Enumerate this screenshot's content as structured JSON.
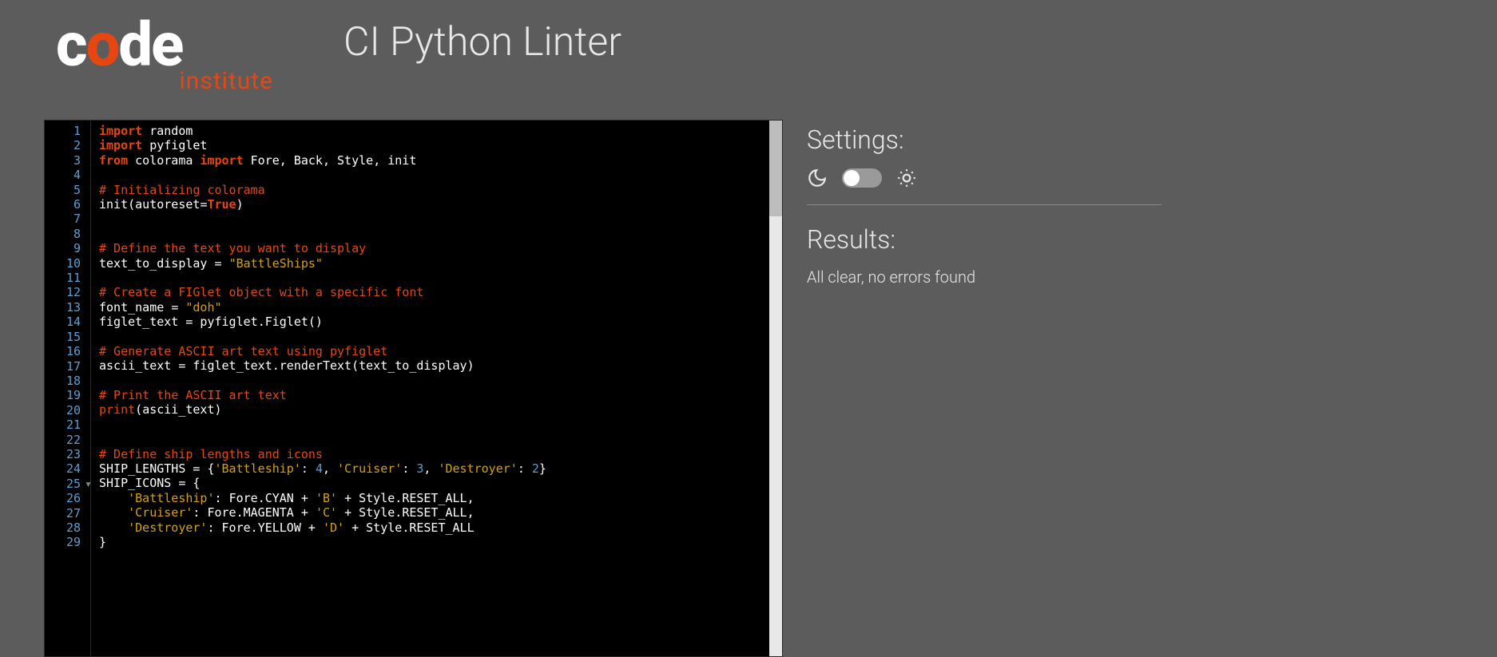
{
  "header": {
    "logo_code_c": "c",
    "logo_code_o": "o",
    "logo_code_de": "de",
    "logo_institute": "institute",
    "title": "CI Python Linter"
  },
  "editor": {
    "line_count": 29,
    "fold_line": 25,
    "lines": [
      [
        [
          "kw",
          "import"
        ],
        [
          "id",
          " random"
        ]
      ],
      [
        [
          "kw",
          "import"
        ],
        [
          "id",
          " pyfiglet"
        ]
      ],
      [
        [
          "kw",
          "from"
        ],
        [
          "id",
          " colorama "
        ],
        [
          "kw",
          "import"
        ],
        [
          "id",
          " Fore"
        ],
        [
          "sep",
          ","
        ],
        [
          "id",
          " Back"
        ],
        [
          "sep",
          ","
        ],
        [
          "id",
          " Style"
        ],
        [
          "sep",
          ","
        ],
        [
          "id",
          " init"
        ]
      ],
      [],
      [
        [
          "cm",
          "# Initializing colorama"
        ]
      ],
      [
        [
          "id",
          "init"
        ],
        [
          "sep",
          "("
        ],
        [
          "id",
          "autoreset"
        ],
        [
          "op",
          "="
        ],
        [
          "bool",
          "True"
        ],
        [
          "sep",
          ")"
        ]
      ],
      [],
      [],
      [
        [
          "cm",
          "# Define the text you want to display"
        ]
      ],
      [
        [
          "id",
          "text_to_display "
        ],
        [
          "op",
          "="
        ],
        [
          "id",
          " "
        ],
        [
          "str",
          "\"BattleShips\""
        ]
      ],
      [],
      [
        [
          "cm",
          "# Create a FIGlet object with a specific font"
        ]
      ],
      [
        [
          "id",
          "font_name "
        ],
        [
          "op",
          "="
        ],
        [
          "id",
          " "
        ],
        [
          "str",
          "\"doh\""
        ]
      ],
      [
        [
          "id",
          "figlet_text "
        ],
        [
          "op",
          "="
        ],
        [
          "id",
          " pyfiglet"
        ],
        [
          "sep",
          "."
        ],
        [
          "id",
          "Figlet"
        ],
        [
          "sep",
          "()"
        ]
      ],
      [],
      [
        [
          "cm",
          "# Generate ASCII art text using pyfiglet"
        ]
      ],
      [
        [
          "id",
          "ascii_text "
        ],
        [
          "op",
          "="
        ],
        [
          "id",
          " figlet_text"
        ],
        [
          "sep",
          "."
        ],
        [
          "id",
          "renderText"
        ],
        [
          "sep",
          "("
        ],
        [
          "id",
          "text_to_display"
        ],
        [
          "sep",
          ")"
        ]
      ],
      [],
      [
        [
          "cm",
          "# Print the ASCII art text"
        ]
      ],
      [
        [
          "fn",
          "print"
        ],
        [
          "sep",
          "("
        ],
        [
          "id",
          "ascii_text"
        ],
        [
          "sep",
          ")"
        ]
      ],
      [],
      [],
      [
        [
          "cm",
          "# Define ship lengths and icons"
        ]
      ],
      [
        [
          "id",
          "SHIP_LENGTHS "
        ],
        [
          "op",
          "="
        ],
        [
          "id",
          " "
        ],
        [
          "sep",
          "{"
        ],
        [
          "str",
          "'Battleship'"
        ],
        [
          "sep",
          ": "
        ],
        [
          "num",
          "4"
        ],
        [
          "sep",
          ", "
        ],
        [
          "str",
          "'Cruiser'"
        ],
        [
          "sep",
          ": "
        ],
        [
          "num",
          "3"
        ],
        [
          "sep",
          ", "
        ],
        [
          "str",
          "'Destroyer'"
        ],
        [
          "sep",
          ": "
        ],
        [
          "num",
          "2"
        ],
        [
          "sep",
          "}"
        ]
      ],
      [
        [
          "id",
          "SHIP_ICONS "
        ],
        [
          "op",
          "="
        ],
        [
          "id",
          " "
        ],
        [
          "sep",
          "{"
        ]
      ],
      [
        [
          "id",
          "    "
        ],
        [
          "str",
          "'Battleship'"
        ],
        [
          "sep",
          ": "
        ],
        [
          "id",
          "Fore"
        ],
        [
          "sep",
          "."
        ],
        [
          "id",
          "CYAN "
        ],
        [
          "op",
          "+"
        ],
        [
          "id",
          " "
        ],
        [
          "str",
          "'B'"
        ],
        [
          "id",
          " "
        ],
        [
          "op",
          "+"
        ],
        [
          "id",
          " Style"
        ],
        [
          "sep",
          "."
        ],
        [
          "id",
          "RESET_ALL"
        ],
        [
          "sep",
          ","
        ]
      ],
      [
        [
          "id",
          "    "
        ],
        [
          "str",
          "'Cruiser'"
        ],
        [
          "sep",
          ": "
        ],
        [
          "id",
          "Fore"
        ],
        [
          "sep",
          "."
        ],
        [
          "id",
          "MAGENTA "
        ],
        [
          "op",
          "+"
        ],
        [
          "id",
          " "
        ],
        [
          "str",
          "'C'"
        ],
        [
          "id",
          " "
        ],
        [
          "op",
          "+"
        ],
        [
          "id",
          " Style"
        ],
        [
          "sep",
          "."
        ],
        [
          "id",
          "RESET_ALL"
        ],
        [
          "sep",
          ","
        ]
      ],
      [
        [
          "id",
          "    "
        ],
        [
          "str",
          "'Destroyer'"
        ],
        [
          "sep",
          ": "
        ],
        [
          "id",
          "Fore"
        ],
        [
          "sep",
          "."
        ],
        [
          "id",
          "YELLOW "
        ],
        [
          "op",
          "+"
        ],
        [
          "id",
          " "
        ],
        [
          "str",
          "'D'"
        ],
        [
          "id",
          " "
        ],
        [
          "op",
          "+"
        ],
        [
          "id",
          " Style"
        ],
        [
          "sep",
          "."
        ],
        [
          "id",
          "RESET_ALL"
        ]
      ],
      [
        [
          "sep",
          "}"
        ]
      ]
    ]
  },
  "sidebar": {
    "settings_heading": "Settings:",
    "results_heading": "Results:",
    "results_text": "All clear, no errors found"
  }
}
